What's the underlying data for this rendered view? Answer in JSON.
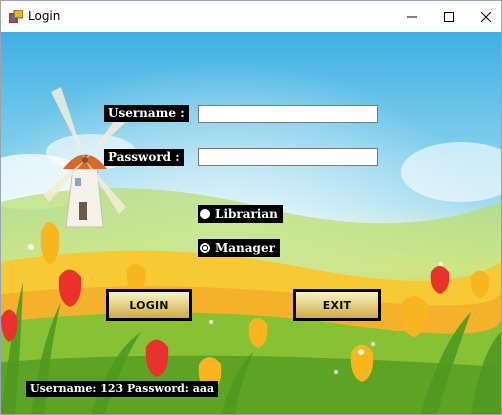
{
  "window": {
    "title": "Login",
    "controls": {
      "minimize": "minimize-icon",
      "maximize": "maximize-icon",
      "close": "close-icon"
    }
  },
  "form": {
    "username_label": "Username :",
    "username_value": "",
    "password_label": "Password :",
    "password_value": "",
    "roles": [
      {
        "label": "Librarian",
        "checked": false
      },
      {
        "label": "Manager",
        "checked": true
      }
    ],
    "login_label": "LOGIN",
    "exit_label": "EXIT"
  },
  "hint": "Username: 123   Password: aaa",
  "colors": {
    "sky_top": "#4fb6e6",
    "field_yellow": "#f7d23a",
    "grass_green": "#78b82a",
    "button_gold": "#e8d58a"
  }
}
